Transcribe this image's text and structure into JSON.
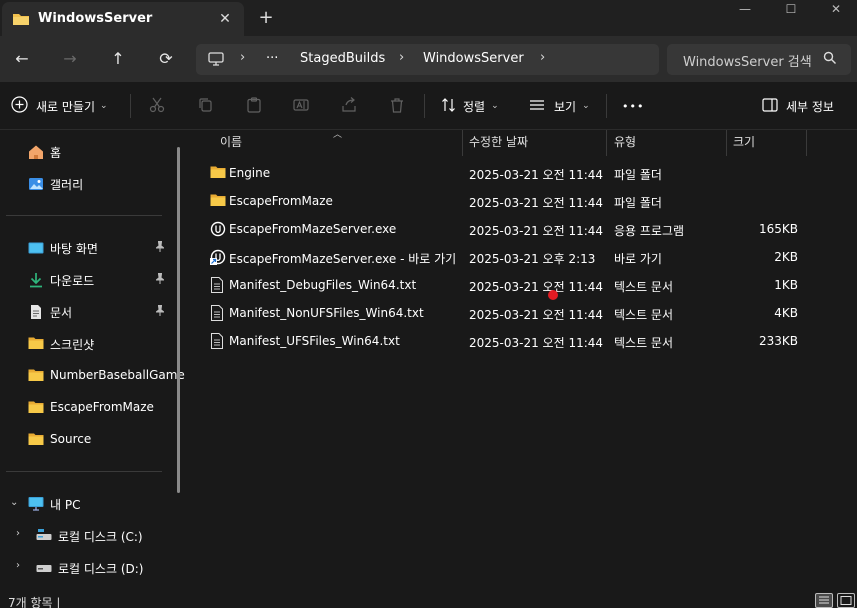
{
  "tab": {
    "title": "WindowsServer",
    "close": "✕",
    "new_tab": "+"
  },
  "window_controls": {
    "minimize": "—",
    "maximize": "☐",
    "close": "✕"
  },
  "nav": {
    "back": "←",
    "forward": "→",
    "up": "↑",
    "refresh": "⟳",
    "breadcrumb": {
      "more": "···",
      "items": [
        "StagedBuilds",
        "WindowsServer"
      ]
    },
    "search_placeholder": "WindowsServer 검색"
  },
  "toolbar": {
    "new_label": "새로 만들기",
    "sort_label": "정렬",
    "view_label": "보기",
    "more": "•••",
    "details_label": "세부 정보"
  },
  "sidebar": {
    "items": [
      {
        "label": "홈",
        "icon": "home-icon"
      },
      {
        "label": "갤러리",
        "icon": "gallery-icon"
      },
      {
        "label": "바탕 화면",
        "icon": "desktop-icon",
        "pinned": true
      },
      {
        "label": "다운로드",
        "icon": "download-icon",
        "pinned": true
      },
      {
        "label": "문서",
        "icon": "document-icon",
        "pinned": true
      },
      {
        "label": "스크린샷",
        "icon": "folder-icon"
      },
      {
        "label": "NumberBaseballGame",
        "icon": "folder-icon"
      },
      {
        "label": "EscapeFromMaze",
        "icon": "folder-icon"
      },
      {
        "label": "Source",
        "icon": "folder-icon"
      },
      {
        "label": "내 PC",
        "icon": "pc-icon"
      },
      {
        "label": "로컬 디스크 (C:)",
        "icon": "drive-icon"
      },
      {
        "label": "로컬 디스크 (D:)",
        "icon": "drive-icon"
      }
    ],
    "pin_glyph": "📌"
  },
  "columns": {
    "name": "이름",
    "modified": "수정한 날짜",
    "type": "유형",
    "size": "크기"
  },
  "files": [
    {
      "name": "Engine",
      "modified": "2025-03-21 오전 11:44",
      "type": "파일 폴더",
      "size": "",
      "icon": "folder-icon"
    },
    {
      "name": "EscapeFromMaze",
      "modified": "2025-03-21 오전 11:44",
      "type": "파일 폴더",
      "size": "",
      "icon": "folder-icon"
    },
    {
      "name": "EscapeFromMazeServer.exe",
      "modified": "2025-03-21 오전 11:44",
      "type": "응용 프로그램",
      "size": "165KB",
      "icon": "unreal-icon"
    },
    {
      "name": "EscapeFromMazeServer.exe - 바로 가기",
      "modified": "2025-03-21 오후 2:13",
      "type": "바로 가기",
      "size": "2KB",
      "icon": "shortcut-icon"
    },
    {
      "name": "Manifest_DebugFiles_Win64.txt",
      "modified": "2025-03-21 오전 11:44",
      "type": "텍스트 문서",
      "size": "1KB",
      "icon": "text-file-icon"
    },
    {
      "name": "Manifest_NonUFSFiles_Win64.txt",
      "modified": "2025-03-21 오전 11:44",
      "type": "텍스트 문서",
      "size": "4KB",
      "icon": "text-file-icon"
    },
    {
      "name": "Manifest_UFSFiles_Win64.txt",
      "modified": "2025-03-21 오전 11:44",
      "type": "텍스트 문서",
      "size": "233KB",
      "icon": "text-file-icon"
    }
  ],
  "status": {
    "item_count": "7개 항목  |"
  },
  "colors": {
    "folder": "#f2c14e",
    "accent": "#4cc2ff",
    "cursor": "#e31b23"
  }
}
